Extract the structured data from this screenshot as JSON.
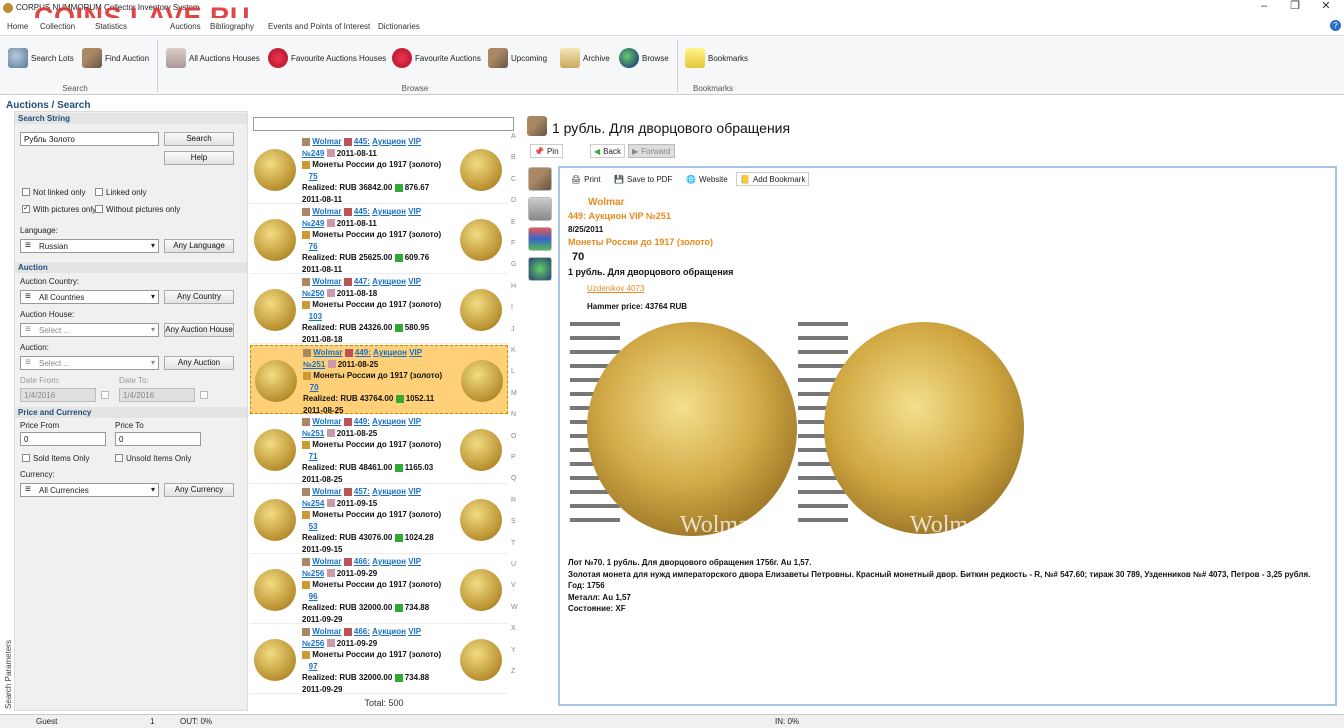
{
  "window": {
    "title": "CORPUS NUMMORUM Collector Inventory System",
    "watermark": "COINS.LAVE.RU",
    "controls": [
      "–",
      "❐",
      "✕"
    ]
  },
  "menu": [
    "Home",
    "Collection",
    "Statistics",
    "Auctions",
    "Bibliography",
    "Events and Points of Interest",
    "Dictionaries"
  ],
  "ribbon": {
    "buttons": [
      {
        "label": "Search Lots",
        "icon": "magnifier-icon"
      },
      {
        "label": "Find Auction",
        "icon": "gavel-icon"
      },
      {
        "label": "All Auctions Houses",
        "icon": "building-icon"
      },
      {
        "label": "Favourite Auctions Houses",
        "icon": "heart-icon"
      },
      {
        "label": "Favourite Auctions",
        "icon": "heart-icon"
      },
      {
        "label": "Upcoming",
        "icon": "gavel-icon"
      },
      {
        "label": "Archive",
        "icon": "scroll-icon"
      },
      {
        "label": "Browse",
        "icon": "globe-icon"
      },
      {
        "label": "Bookmarks",
        "icon": "note-icon"
      }
    ],
    "groups": [
      "Search",
      "Browse",
      "Bookmarks"
    ]
  },
  "breadcrumb": "Auctions / Search",
  "search": {
    "section": "Search String",
    "value": "Рубль Золото",
    "search_btn": "Search",
    "help_btn": "Help",
    "not_linked": "Not linked only",
    "linked": "Linked only",
    "with_pictures": "With pictures only",
    "without_pictures": "Without pictures only",
    "language_label": "Language:",
    "language": "Russian",
    "any_language": "Any Language"
  },
  "auction": {
    "section": "Auction",
    "country_label": "Auction Country:",
    "country": "All Countries",
    "any_country": "Any Country",
    "house_label": "Auction House:",
    "house": "Select ...",
    "any_house": "Any Auction House",
    "auction_label": "Auction:",
    "auction": "Select ...",
    "any_auction": "Any Auction",
    "date_from_label": "Date From:",
    "date_from": "1/4/2016",
    "date_to_label": "Date To:",
    "date_to": "1/4/2016"
  },
  "price": {
    "section": "Price and Currency",
    "from_label": "Price From",
    "from": "0",
    "to_label": "Price To",
    "to": "0",
    "sold": "Sold Items Only",
    "unsold": "Unsold Items Only",
    "currency_label": "Currency:",
    "currency": "All Currencies",
    "any_currency": "Any Currency"
  },
  "side_tab": "Search Parameters",
  "results": [
    {
      "house": "Wolmar",
      "num": "445:",
      "name": "Аукцион",
      "vip": "VIP",
      "no": "№249",
      "date": "2011-08-11",
      "cat": "Монеты России до 1917 (золото)",
      "lot": "75",
      "realized": "Realized: RUB  36842.00",
      "usd": "876.67",
      "date2": "2011-08-11"
    },
    {
      "house": "Wolmar",
      "num": "445:",
      "name": "Аукцион",
      "vip": "VIP",
      "no": "№249",
      "date": "2011-08-11",
      "cat": "Монеты России до 1917 (золото)",
      "lot": "76",
      "realized": "Realized: RUB  25625.00",
      "usd": "609.76",
      "date2": "2011-08-11"
    },
    {
      "house": "Wolmar",
      "num": "447:",
      "name": "Аукцион",
      "vip": "VIP",
      "no": "№250",
      "date": "2011-08-18",
      "cat": "Монеты России до 1917 (золото)",
      "lot": "103",
      "realized": "Realized: RUB  24326.00",
      "usd": "580.95",
      "date2": "2011-08-18"
    },
    {
      "house": "Wolmar",
      "num": "449:",
      "name": "Аукцион",
      "vip": "VIP",
      "no": "№251",
      "date": "2011-08-25",
      "cat": "Монеты России до 1917 (золото)",
      "lot": "70",
      "realized": "Realized: RUB  43764.00",
      "usd": "1052.11",
      "date2": "2011-08-25"
    },
    {
      "house": "Wolmar",
      "num": "449:",
      "name": "Аукцион",
      "vip": "VIP",
      "no": "№251",
      "date": "2011-08-25",
      "cat": "Монеты России до 1917 (золото)",
      "lot": "71",
      "realized": "Realized: RUB  48461.00",
      "usd": "1165.03",
      "date2": "2011-08-25"
    },
    {
      "house": "Wolmar",
      "num": "457:",
      "name": "Аукцион",
      "vip": "VIP",
      "no": "№254",
      "date": "2011-09-15",
      "cat": "Монеты России до 1917 (золото)",
      "lot": "53",
      "realized": "Realized: RUB  43076.00",
      "usd": "1024.28",
      "date2": "2011-09-15"
    },
    {
      "house": "Wolmar",
      "num": "466:",
      "name": "Аукцион",
      "vip": "VIP",
      "no": "№256",
      "date": "2011-09-29",
      "cat": "Монеты России до 1917 (золото)",
      "lot": "96",
      "realized": "Realized: RUB  32000.00",
      "usd": "734.88",
      "date2": "2011-09-29"
    },
    {
      "house": "Wolmar",
      "num": "466:",
      "name": "Аукцион",
      "vip": "VIP",
      "no": "№256",
      "date": "2011-09-29",
      "cat": "Монеты России до 1917 (золото)",
      "lot": "97",
      "realized": "Realized: RUB  32000.00",
      "usd": "734.88",
      "date2": "2011-09-29"
    }
  ],
  "alpha": [
    "A",
    "B",
    "C",
    "D",
    "E",
    "F",
    "G",
    "H",
    "I",
    "J",
    "K",
    "L",
    "M",
    "N",
    "O",
    "P",
    "Q",
    "R",
    "S",
    "T",
    "U",
    "V",
    "W",
    "X",
    "Y",
    "Z"
  ],
  "total": "Total:  500",
  "detail": {
    "title": "1 рубль. Для дворцового обращения",
    "pin": "Pin",
    "back": "Back",
    "forward": "Forward",
    "print": "Print",
    "pdf": "Save to PDF",
    "website": "Website",
    "bookmark": "Add Bookmark",
    "house": "Wolmar",
    "auction": "449: Аукцион VIP №251",
    "date": "8/25/2011",
    "category": "Монеты России до 1917 (золото)",
    "lot": "70",
    "name": "1 рубль. Для дворцового обращения",
    "ref": "Uzdenikov 4073",
    "hammer": "Hammer price: 43764 RUB",
    "coin_wm": "Wolmar",
    "desc": [
      "Лот №70.  1 рубль. Для дворцового обращения 1756г. Au 1,57.",
      "Золотая монета для нужд императорского двора Елизаветы Петровны. Красный монетный двор. Биткин редкость - R, №# 547.60; тираж 30 789, Узденников №# 4073, Петров - 3,25 рубля.",
      "Год: 1756",
      "Металл: Au 1,57",
      "Состояние: XF"
    ]
  },
  "status": {
    "user": "Guest",
    "count": "1",
    "out": "OUT: 0%",
    "in": "IN: 0%"
  }
}
